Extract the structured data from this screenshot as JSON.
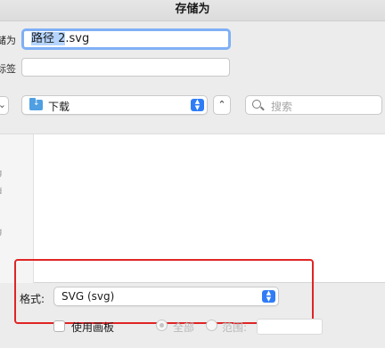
{
  "window": {
    "title": "存储为"
  },
  "form": {
    "save_as_label": "存储为:",
    "tags_label": "标签:",
    "filename": {
      "selected": "路径 2",
      "rest": ".svg"
    }
  },
  "toolbar": {
    "location": "下载",
    "search_placeholder": "搜索"
  },
  "sidebar": {
    "items": [
      "g",
      "d",
      "g"
    ]
  },
  "options": {
    "format_label": "格式:",
    "format_value": "SVG (svg)",
    "use_artboards": "使用画板",
    "all_label": "全部",
    "range_label": "范围:"
  },
  "colors": {
    "accent": "#2f7df6",
    "focus_ring": "#7fb0f5",
    "annotation": "#e02424"
  }
}
